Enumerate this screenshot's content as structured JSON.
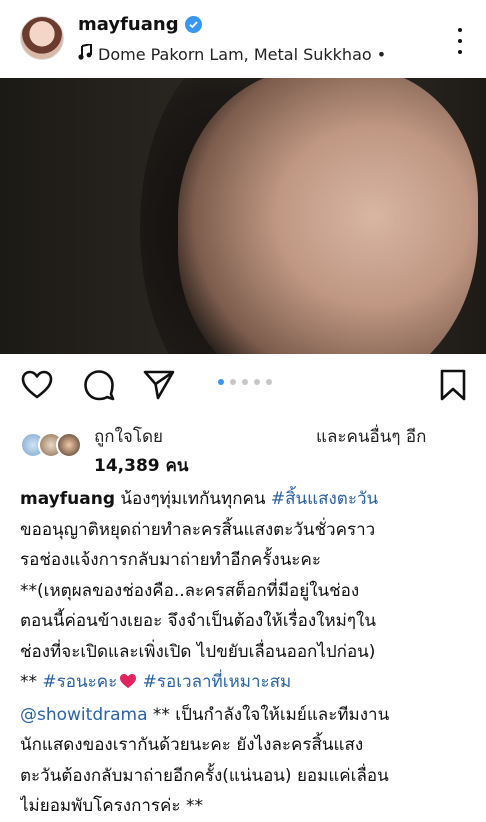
{
  "post": {
    "username": "mayfuang",
    "music": "Dome Pakorn Lam, Metal Sukkhao •"
  },
  "likes": {
    "liked_by": "ถูกใจโดย",
    "and_others": "และคนอื่นๆ อีก",
    "count": "14,389 คน"
  },
  "caption": {
    "username": "mayfuang",
    "line1_text": "น้องๆทุ่มเทกันทุกคน",
    "line1_tag": "#สิ้นแสงตะวัน",
    "line2": "ขออนุญาติหยุดถ่ายทำละครสิ้นแสงตะวันชั่วคราว",
    "line3": "รอช่องแจ้งการกลับมาถ่ายทำอีกครั้งนะคะ",
    "line4": "**(เหตุผลของช่องคือ..ละครสต็อกที่มีอยู่ในช่อง",
    "line5": "ตอนนี้ค่อนข้างเยอะ จึงจำเป็นต้องให้เรื่องใหม่ๆใน",
    "line6": "ช่องที่จะเปิดและเพิ่งเปิด ไปขยับเลื่อนออกไปก่อน)",
    "line7_prefix": "**",
    "line7_tag1": "#รอนะคะ",
    "line7_tag2": "#รอเวลาที่เหมาะสม",
    "line8_mention": "@showitdrama",
    "line8_text": "** เป็นกำลังใจให้เมย์และทีมงาน",
    "line9": "นักแสดงของเรากันด้วยนะคะ ยังไงละครสิ้นแสง",
    "line10": "ตะวันต้องกลับมาถ่ายอีกครั้ง(แน่นอน) ยอมแค่เลื่อน",
    "line11": "ไม่ยอมพับโครงการค่ะ **"
  },
  "icons": {
    "verified": "verified-badge-icon",
    "music": "music-note-icon",
    "more": "more-options-icon",
    "mute": "muted-speaker-icon",
    "like": "heart-icon",
    "comment": "comment-icon",
    "share": "paper-plane-icon",
    "save": "bookmark-icon"
  },
  "colors": {
    "accent_blue": "#3897f0",
    "hashtag": "#2a62a6",
    "heart_emoji": "#e0245e"
  },
  "carousel": {
    "total": 5,
    "active": 1
  }
}
